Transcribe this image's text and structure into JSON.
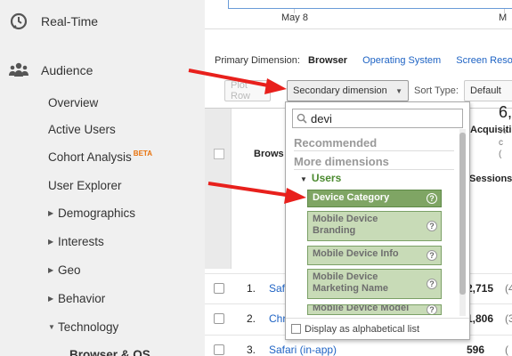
{
  "sidebar": {
    "realtime_label": "Real-Time",
    "audience_label": "Audience",
    "items": [
      {
        "label": "Overview"
      },
      {
        "label": "Active Users"
      },
      {
        "label": "Cohort Analysis",
        "badge": "BETA"
      },
      {
        "label": "User Explorer"
      },
      {
        "label": "Demographics"
      },
      {
        "label": "Interests"
      },
      {
        "label": "Geo"
      },
      {
        "label": "Behavior"
      },
      {
        "label": "Technology"
      },
      {
        "label": "Browser & OS"
      }
    ]
  },
  "chart": {
    "x_label_1": "May 8",
    "x_label_2": "M"
  },
  "dimensions": {
    "label": "Primary Dimension:",
    "current": "Browser",
    "link_os": "Operating System",
    "link_screen": "Screen Resol"
  },
  "toolbar": {
    "plot_rows": "Plot Row",
    "secondary_dimension": "Secondary dimension",
    "sort_type_label": "Sort Type:",
    "sort_value": "Default"
  },
  "table": {
    "header_browser": "Brows",
    "header_acquisition": "Acquisitio",
    "header_sessions": "Sessions",
    "summary_value": "6,",
    "summary_pct_1": "% c",
    "summary_pct_2": "(",
    "rows": [
      {
        "num": "1.",
        "name": "Safa",
        "value": "2,715",
        "pct": "(4"
      },
      {
        "num": "2.",
        "name": "Chr",
        "value": "1,806",
        "pct": "(3"
      },
      {
        "num": "3.",
        "name": "Safari (in-app)",
        "value": "596",
        "pct": "("
      }
    ]
  },
  "dropdown": {
    "search_value": "devi",
    "recommended": "Recommended",
    "more_dimensions": "More dimensions",
    "group": "Users",
    "items": [
      {
        "label": "Device Category"
      },
      {
        "label": "Mobile Device Branding"
      },
      {
        "label": "Mobile Device Info"
      },
      {
        "label": "Mobile Device Marketing Name"
      },
      {
        "label": "Mobile Device Model"
      }
    ],
    "help_glyph": "?",
    "alphabetical": "Display as alphabetical list"
  },
  "colors": {
    "arrow": "#e8201c",
    "link": "#1e63c4",
    "selected_item": "#7fa564",
    "item_bg": "#c8dbb7",
    "group": "#4b8a2f"
  }
}
